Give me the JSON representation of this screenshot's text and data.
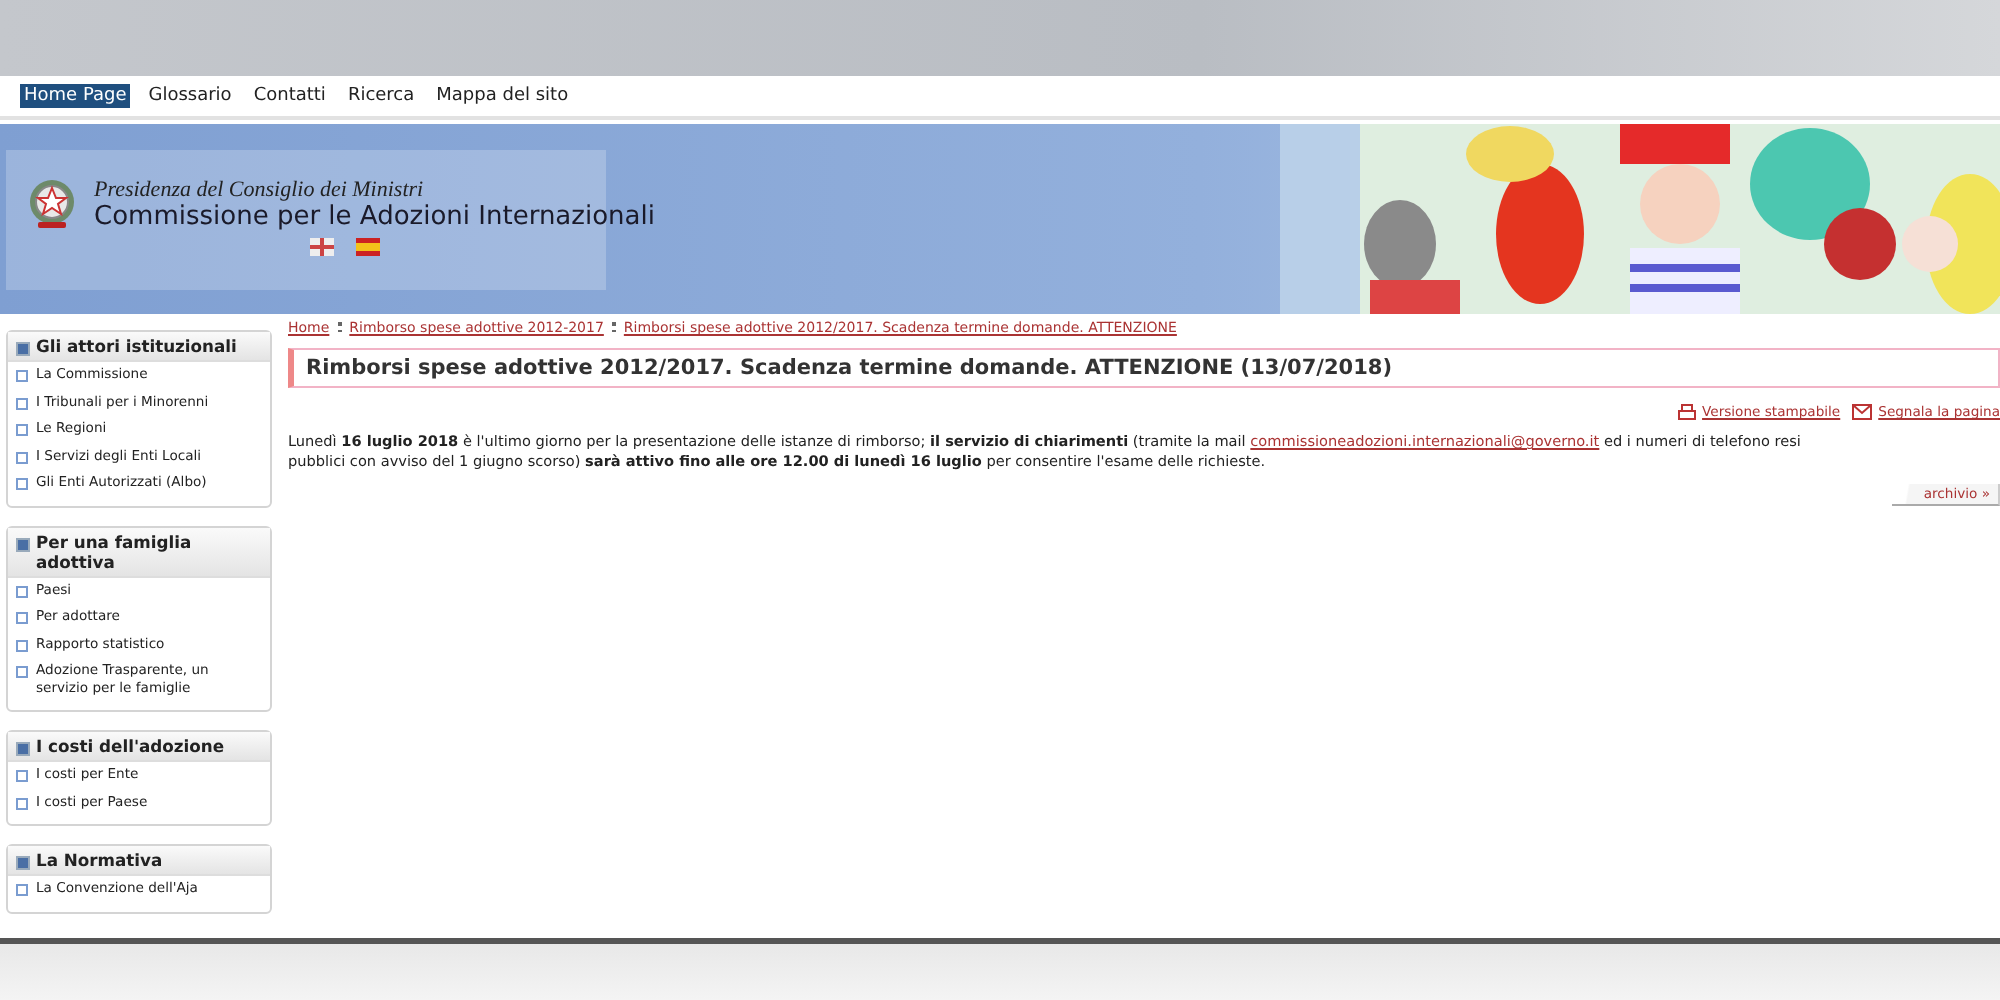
{
  "nav": [
    {
      "label": "Home Page",
      "selected": true
    },
    {
      "label": "Glossario",
      "selected": false
    },
    {
      "label": "Contatti",
      "selected": false
    },
    {
      "label": "Ricerca",
      "selected": false
    },
    {
      "label": "Mappa del sito",
      "selected": false
    }
  ],
  "header": {
    "subtitle": "Presidenza del Consiglio dei Ministri",
    "title": "Commissione per le Adozioni Internazionali"
  },
  "sidebar": [
    {
      "title": "Gli attori istituzionali",
      "items": [
        "La Commissione",
        "I Tribunali per i Minorenni",
        "Le Regioni",
        "I Servizi degli Enti Locali",
        "Gli Enti Autorizzati (Albo)"
      ]
    },
    {
      "title": "Per una famiglia adottiva",
      "items": [
        "Paesi",
        "Per adottare",
        "Rapporto statistico",
        "Adozione Trasparente, un servizio per le famiglie"
      ]
    },
    {
      "title": "I costi dell'adozione",
      "items": [
        "I costi per Ente",
        "I costi per Paese"
      ]
    },
    {
      "title": "La Normativa",
      "items": [
        "La Convenzione dell'Aja"
      ]
    }
  ],
  "breadcrumb": [
    "Home",
    "Rimborso spese adottive 2012-2017",
    "Rimborsi spese adottive 2012/2017. Scadenza termine domande. ATTENZIONE"
  ],
  "article": {
    "title": "Rimborsi spese adottive 2012/2017. Scadenza termine domande. ATTENZIONE (13/07/2018)",
    "tools": [
      "Versione stampabile",
      "Segnala la pagina"
    ],
    "line_1_before": "Lunedì **16 luglio 2018** è l'ultimo giorno per la presentazione delle istanze di rimborso; **il servizio di chiarimenti** (tramite la mail",
    "email": "commissioneadozioni.internazionali@governo.it",
    "line_1_after": "ed i numeri di telefono resi",
    "line_2": "pubblici con avviso del 1 giugno scorso) **sarà attivo fino alle ore 12.00 di lunedì 16 luglio** per consentire l'esame delle richieste.",
    "archive": "archivio »"
  }
}
